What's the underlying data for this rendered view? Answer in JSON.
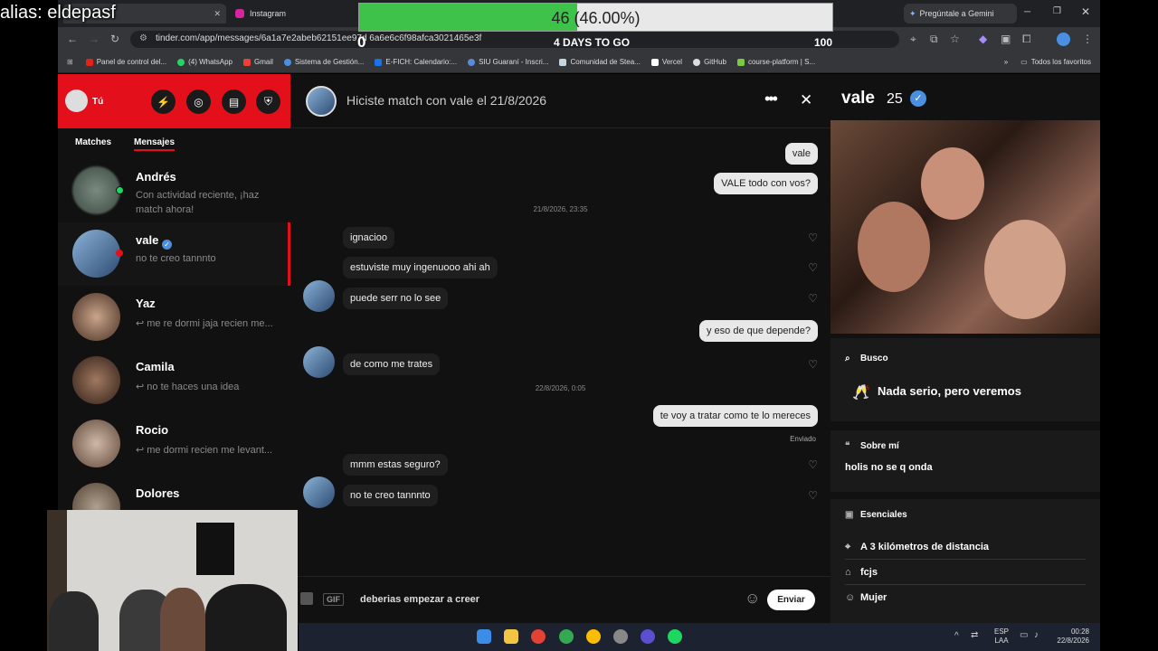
{
  "overlay": {
    "alias": "alias: eldepasf",
    "progress_value": 46,
    "progress_percent": 0.46,
    "progress_text": "46 (46.00%)",
    "min": "0",
    "days_label": "4 DAYS TO GO",
    "max": "100",
    "bar_color": "#3fc24a"
  },
  "browser": {
    "tabs": [
      "Instagram"
    ],
    "gemini_button": "Pregúntale a Gemini",
    "url": "tinder.com/app/messages/6a1a7e2abeb62151ee97d   6a6e6c6f98afca3021465e3f",
    "bookmarks": [
      "Panel de control del...",
      "(4) WhatsApp",
      "Gmail",
      "Sistema de Gestión...",
      "E-FICH: Calendario:...",
      "SIU Guaraní - Inscri...",
      "Comunidad de Stea...",
      "Vercel",
      "GitHub",
      "course-platform | S..."
    ],
    "all_bookmarks": "Todos los favoritos"
  },
  "sidebar": {
    "user": "Tú",
    "tab_matches": "Matches",
    "tab_messages": "Mensajes",
    "accent": "#e3101b",
    "conversations": [
      {
        "name": "Andrés",
        "preview": "Con actividad reciente, ¡haz match ahora!"
      },
      {
        "name": "vale",
        "preview": "no te creo tannnto"
      },
      {
        "name": "Yaz",
        "preview": "↩ me re dormi jaja recien me..."
      },
      {
        "name": "Camila",
        "preview": "↩ no te haces una idea"
      },
      {
        "name": "Rocio",
        "preview": "↩ me dormi recien me levant..."
      },
      {
        "name": "Dolores",
        "preview": ""
      }
    ]
  },
  "chat": {
    "header": "Hiciste match con vale el 21/8/2026",
    "messages": [
      {
        "dir": "out",
        "text": "vale"
      },
      {
        "dir": "out",
        "text": "VALE todo con vos?"
      },
      {
        "dir": "stamp",
        "text": "21/8/2026, 23:35"
      },
      {
        "dir": "in",
        "text": "ignacioo"
      },
      {
        "dir": "in",
        "text": "estuviste muy ingenuooo ahi ah"
      },
      {
        "dir": "in",
        "text": "puede serr no lo see"
      },
      {
        "dir": "out",
        "text": "y eso de que depende?"
      },
      {
        "dir": "in",
        "text": "de como me trates"
      },
      {
        "dir": "stamp",
        "text": "22/8/2026, 0:05"
      },
      {
        "dir": "out",
        "text": "te voy a tratar como te lo mereces"
      },
      {
        "dir": "status",
        "text": "Enviado"
      },
      {
        "dir": "in",
        "text": "mmm estas seguro?"
      },
      {
        "dir": "in",
        "text": "no te creo tannnto"
      }
    ],
    "gif_label": "GIF",
    "draft": "deberias empezar a creer",
    "send": "Enviar"
  },
  "profile": {
    "name": "vale",
    "age": "25",
    "busco_label": "Busco",
    "busco_value": "Nada serio, pero veremos",
    "about_label": "Sobre mí",
    "about_value": "holis no se q onda",
    "essentials_label": "Esenciales",
    "essentials": [
      "A 3 kilómetros de distancia",
      "fcjs",
      "Mujer"
    ]
  },
  "taskbar": {
    "lang1": "ESP",
    "lang2": "LAA",
    "time": "00:28",
    "date": "22/8/2026"
  }
}
